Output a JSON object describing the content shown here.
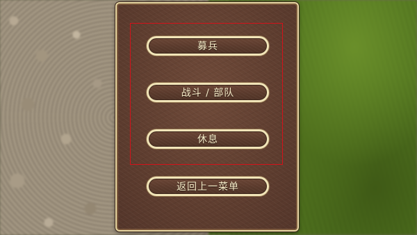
{
  "menu": {
    "buttons": [
      {
        "id": "recruit",
        "label": "募兵"
      },
      {
        "id": "battle",
        "label": "战斗 / 部队"
      },
      {
        "id": "rest",
        "label": "休息"
      },
      {
        "id": "back",
        "label": "返回上一菜单"
      }
    ]
  },
  "colors": {
    "panel_border": "#e8d9a4",
    "panel_fill": "#5e3d2f",
    "button_text": "#f6ecc8",
    "highlight_box": "#d4121a"
  }
}
